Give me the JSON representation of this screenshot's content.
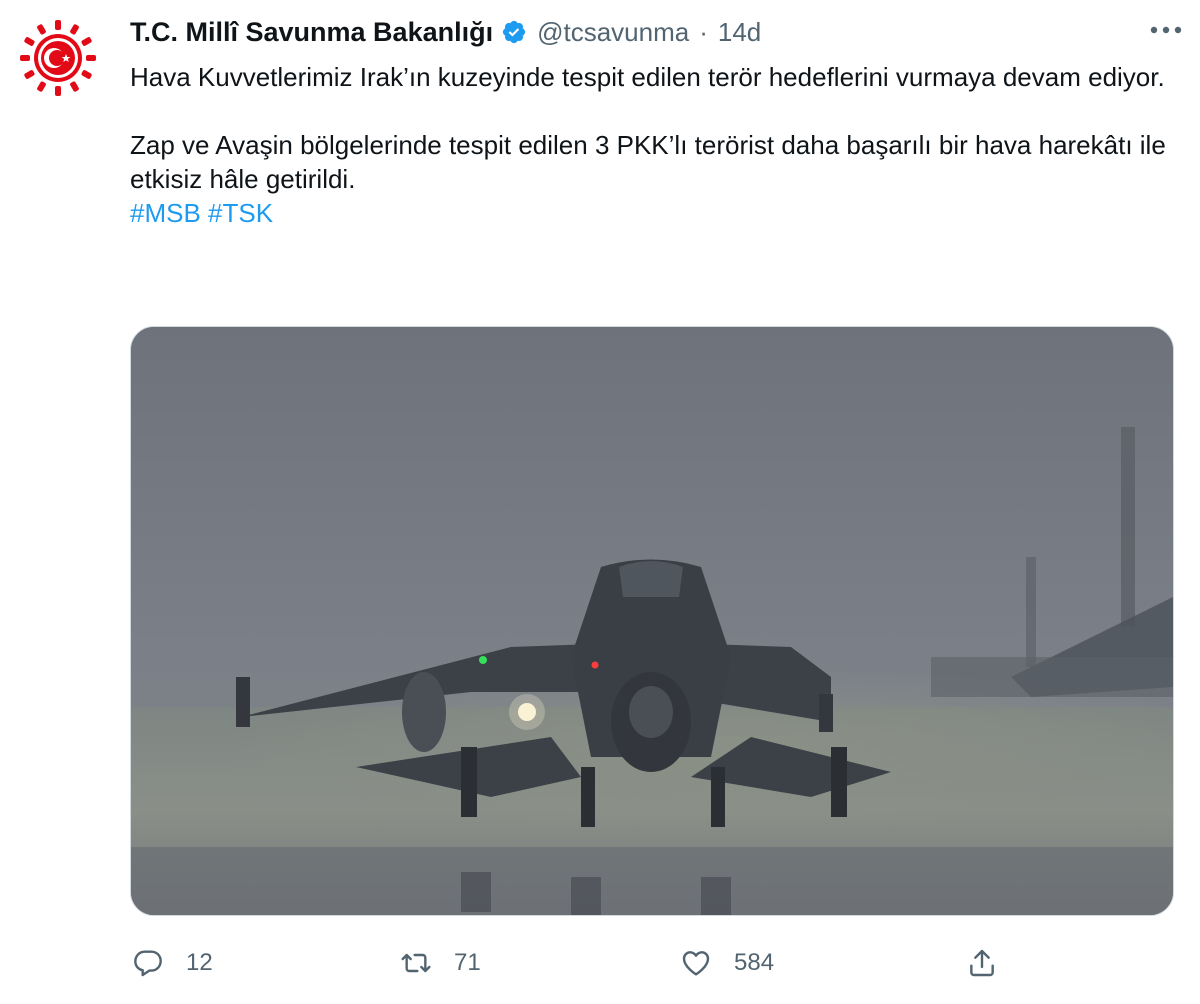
{
  "tweet": {
    "display_name": "T.C. Millî Savunma Bakanlığı",
    "handle": "@tcsavunma",
    "separator": "·",
    "time": "14d",
    "paragraph1": "Hava Kuvvetlerimiz Irak’ın kuzeyinde tespit edilen terör hedeflerini vurmaya devam ediyor.",
    "paragraph2": "Zap ve Avaşin bölgelerinde tespit edilen 3 PKK’lı terörist daha başarılı bir hava harekâtı ile etkisiz hâle getirildi.",
    "hashtags": "#MSB #TSK"
  },
  "actions": {
    "reply_count": "12",
    "retweet_count": "71",
    "like_count": "584"
  },
  "icons": {
    "avatar": "ministry-emblem-icon",
    "verified": "verified-badge-icon",
    "more": "more-options-icon",
    "reply": "reply-icon",
    "retweet": "retweet-icon",
    "like": "heart-icon",
    "share": "share-icon"
  },
  "colors": {
    "text": "#0f1419",
    "secondary": "#536471",
    "link": "#1d9bf0",
    "emblem_red": "#e30a17"
  }
}
